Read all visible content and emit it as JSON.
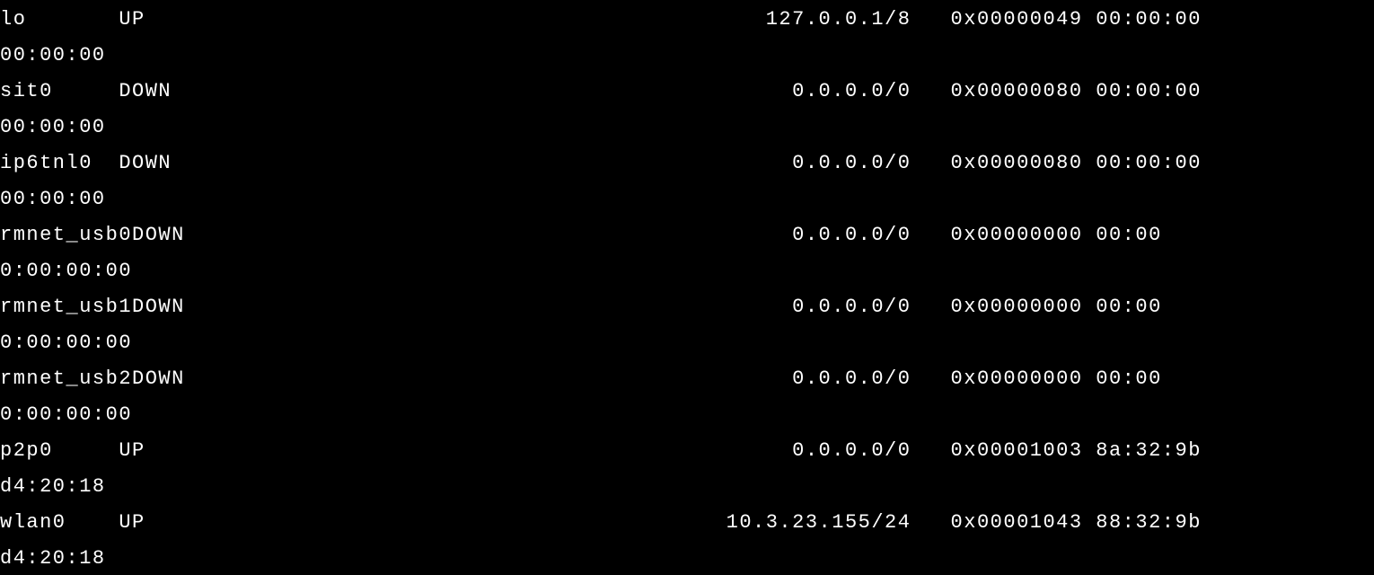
{
  "interfaces": [
    {
      "name": "lo",
      "state": "UP",
      "addr": "127.0.0.1/8",
      "flags": "0x00000049",
      "mac_tail": "00:00:00",
      "cont": "00:00:00"
    },
    {
      "name": "sit0",
      "state": "DOWN",
      "addr": "0.0.0.0/0",
      "flags": "0x00000080",
      "mac_tail": "00:00:00",
      "cont": "00:00:00"
    },
    {
      "name": "ip6tnl0",
      "state": "DOWN",
      "addr": "0.0.0.0/0",
      "flags": "0x00000080",
      "mac_tail": "00:00:00",
      "cont": "00:00:00"
    },
    {
      "name": "rmnet_usb0",
      "state": "DOWN",
      "addr": "0.0.0.0/0",
      "flags": "0x00000000",
      "mac_tail": "00:00",
      "cont": "0:00:00:00"
    },
    {
      "name": "rmnet_usb1",
      "state": "DOWN",
      "addr": "0.0.0.0/0",
      "flags": "0x00000000",
      "mac_tail": "00:00",
      "cont": "0:00:00:00"
    },
    {
      "name": "rmnet_usb2",
      "state": "DOWN",
      "addr": "0.0.0.0/0",
      "flags": "0x00000000",
      "mac_tail": "00:00",
      "cont": "0:00:00:00"
    },
    {
      "name": "p2p0",
      "state": "UP",
      "addr": "0.0.0.0/0",
      "flags": "0x00001003",
      "mac_tail": "8a:32:9b",
      "cont": "d4:20:18"
    },
    {
      "name": "wlan0",
      "state": "UP",
      "addr": "10.3.23.155/24",
      "flags": "0x00001043",
      "mac_tail": "88:32:9b",
      "cont": "d4:20:18"
    }
  ],
  "layout": {
    "name_pad": 9,
    "state_col_start": 9,
    "addr_col_end": 69,
    "flags_col_start": 72,
    "mac_col_start": 83
  }
}
